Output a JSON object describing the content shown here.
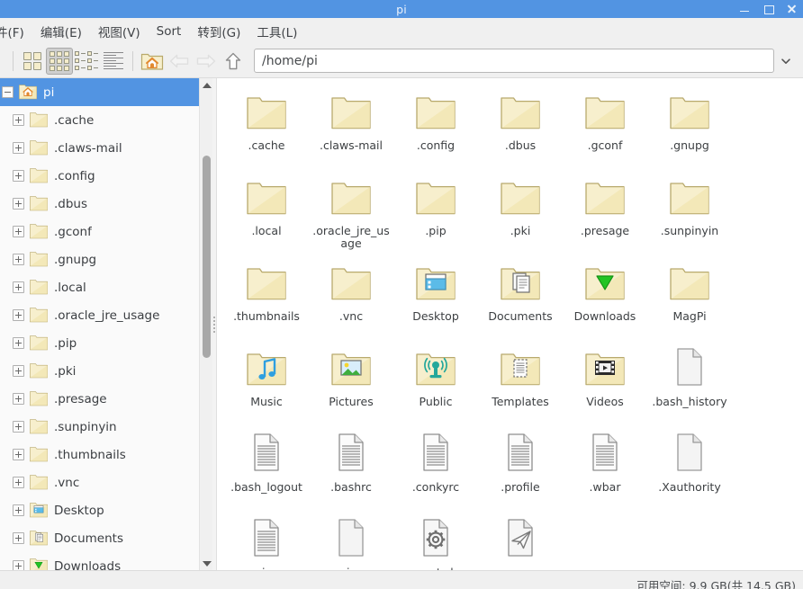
{
  "window": {
    "title": "pi",
    "minimize_label": "minimize",
    "maximize_label": "maximize",
    "close_label": "close"
  },
  "menubar": {
    "items": [
      {
        "label": "件(F)"
      },
      {
        "label": "编辑(E)"
      },
      {
        "label": "视图(V)"
      },
      {
        "label": "Sort"
      },
      {
        "label": "转到(G)"
      },
      {
        "label": "工具(L)"
      }
    ]
  },
  "toolbar": {
    "view_large_icons": "large-icons-view",
    "view_small_icons": "small-icons-view",
    "view_compact_list": "compact-list-view",
    "view_detailed_list": "detailed-list-view",
    "home_label": "Home",
    "back_label": "Back",
    "forward_label": "Forward",
    "up_label": "Up"
  },
  "pathbar": {
    "value": "/home/pi",
    "placeholder": "/home/pi"
  },
  "sidebar": {
    "items": [
      {
        "label": "pi",
        "icon": "home-folder",
        "selected": true,
        "expanded": true
      },
      {
        "label": ".cache",
        "icon": "folder",
        "selected": false,
        "expanded": false
      },
      {
        "label": ".claws-mail",
        "icon": "folder",
        "selected": false,
        "expanded": false
      },
      {
        "label": ".config",
        "icon": "folder",
        "selected": false,
        "expanded": false
      },
      {
        "label": ".dbus",
        "icon": "folder",
        "selected": false,
        "expanded": false
      },
      {
        "label": ".gconf",
        "icon": "folder",
        "selected": false,
        "expanded": false
      },
      {
        "label": ".gnupg",
        "icon": "folder",
        "selected": false,
        "expanded": false
      },
      {
        "label": ".local",
        "icon": "folder",
        "selected": false,
        "expanded": false
      },
      {
        "label": ".oracle_jre_usage",
        "icon": "folder",
        "selected": false,
        "expanded": false
      },
      {
        "label": ".pip",
        "icon": "folder",
        "selected": false,
        "expanded": false
      },
      {
        "label": ".pki",
        "icon": "folder",
        "selected": false,
        "expanded": false
      },
      {
        "label": ".presage",
        "icon": "folder",
        "selected": false,
        "expanded": false
      },
      {
        "label": ".sunpinyin",
        "icon": "folder",
        "selected": false,
        "expanded": false
      },
      {
        "label": ".thumbnails",
        "icon": "folder",
        "selected": false,
        "expanded": false
      },
      {
        "label": ".vnc",
        "icon": "folder",
        "selected": false,
        "expanded": false
      },
      {
        "label": "Desktop",
        "icon": "desktop-folder",
        "selected": false,
        "expanded": false
      },
      {
        "label": "Documents",
        "icon": "documents-folder",
        "selected": false,
        "expanded": false
      },
      {
        "label": "Downloads",
        "icon": "downloads-folder",
        "selected": false,
        "expanded": false
      }
    ]
  },
  "files": {
    "items": [
      {
        "name": ".cache",
        "icon": "folder"
      },
      {
        "name": ".claws-mail",
        "icon": "folder"
      },
      {
        "name": ".config",
        "icon": "folder"
      },
      {
        "name": ".dbus",
        "icon": "folder"
      },
      {
        "name": ".gconf",
        "icon": "folder"
      },
      {
        "name": ".gnupg",
        "icon": "folder"
      },
      {
        "name": ".local",
        "icon": "folder"
      },
      {
        "name": ".oracle_jre_usage",
        "icon": "folder"
      },
      {
        "name": ".pip",
        "icon": "folder"
      },
      {
        "name": ".pki",
        "icon": "folder"
      },
      {
        "name": ".presage",
        "icon": "folder"
      },
      {
        "name": ".sunpinyin",
        "icon": "folder"
      },
      {
        "name": ".thumbnails",
        "icon": "folder"
      },
      {
        "name": ".vnc",
        "icon": "folder"
      },
      {
        "name": "Desktop",
        "icon": "desktop-folder"
      },
      {
        "name": "Documents",
        "icon": "documents-folder"
      },
      {
        "name": "Downloads",
        "icon": "downloads-folder"
      },
      {
        "name": "MagPi",
        "icon": "folder"
      },
      {
        "name": "Music",
        "icon": "music-folder"
      },
      {
        "name": "Pictures",
        "icon": "pictures-folder"
      },
      {
        "name": "Public",
        "icon": "public-folder"
      },
      {
        "name": "Templates",
        "icon": "templates-folder"
      },
      {
        "name": "Videos",
        "icon": "videos-folder"
      },
      {
        "name": ".bash_history",
        "icon": "blank-file"
      },
      {
        "name": ".bash_logout",
        "icon": "text-file"
      },
      {
        "name": ".bashrc",
        "icon": "text-file"
      },
      {
        "name": ".conkyrc",
        "icon": "text-file"
      },
      {
        "name": ".profile",
        "icon": "text-file"
      },
      {
        "name": ".wbar",
        "icon": "text-file"
      },
      {
        "name": ".Xauthority",
        "icon": "blank-file"
      },
      {
        "name": ".xsession-errors",
        "icon": "text-file"
      },
      {
        "name": ".xsession-errors.old",
        "icon": "blank-file"
      },
      {
        "name": "nwct.sh",
        "icon": "script-file"
      },
      {
        "name": "sunny",
        "icon": "sunny-file"
      }
    ]
  },
  "statusbar": {
    "text": "可用空间: 9.9 GB(共 14.5 GB)"
  },
  "colors": {
    "titlebar": "#5294e2",
    "selection": "#5294e2",
    "folder": "#f6eec8",
    "chrome": "#f0f0f0"
  }
}
